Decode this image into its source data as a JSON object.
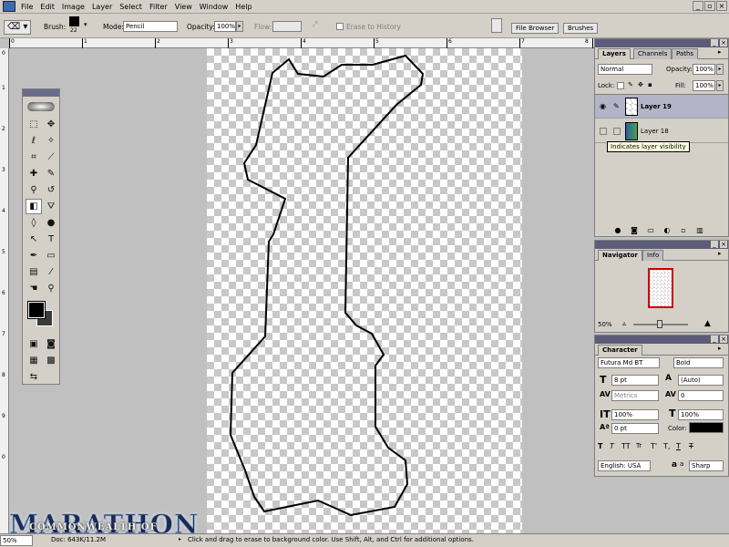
{
  "menu": {
    "items": [
      "File",
      "Edit",
      "Image",
      "Layer",
      "Select",
      "Filter",
      "View",
      "Window",
      "Help"
    ]
  },
  "options": {
    "brush_label": "Brush:",
    "brush_size": "22",
    "mode_label": "Mode:",
    "mode_value": "Pencil",
    "opacity_label": "Opacity:",
    "opacity_value": "100%",
    "flow_label": "Flow:",
    "flow_value": "",
    "erase_history_label": "Erase to History",
    "file_browser": "File Browser",
    "brushes": "Brushes"
  },
  "ruler": {
    "top_labels": [
      "0",
      "1",
      "2",
      "3",
      "4",
      "5",
      "6",
      "7",
      "8"
    ],
    "left_labels": [
      "0",
      "1",
      "2",
      "3",
      "4",
      "5",
      "6",
      "7",
      "8",
      "9",
      "0"
    ]
  },
  "layers_panel": {
    "tabs": [
      "Layers",
      "Channels",
      "Paths"
    ],
    "blend_mode": "Normal",
    "opacity_label": "Opacity:",
    "opacity_value": "100%",
    "lock_label": "Lock:",
    "fill_label": "Fill:",
    "fill_value": "100%",
    "layers": [
      {
        "name": "Layer 19",
        "selected": true
      },
      {
        "name": "Layer 18",
        "selected": false
      }
    ],
    "tooltip": "Indicates layer visibility"
  },
  "navigator_panel": {
    "tabs": [
      "Navigator",
      "Info"
    ],
    "zoom": "50%"
  },
  "character_panel": {
    "tabs": [
      "Character"
    ],
    "font_family": "Futura Md BT",
    "font_style": "Bold",
    "size": "8 pt",
    "leading": "(Auto)",
    "kerning": "Metrics",
    "tracking": "0",
    "vscale": "100%",
    "hscale": "100%",
    "baseline": "0 pt",
    "color_label": "Color:",
    "style_buttons": [
      "T",
      "T",
      "TT",
      "Tr",
      "T'",
      "T,",
      "T",
      "T"
    ],
    "language": "English: USA",
    "aa_label": "a",
    "antialias": "Sharp"
  },
  "status": {
    "zoom": "50%",
    "doc": "Doc: 643K/11.2M",
    "hint": "Click and drag to erase to background color.  Use Shift, Alt, and Ctrl for additional options."
  },
  "logo": {
    "main": "MARATHON",
    "sub": "COMMONWEALTH OF"
  },
  "colors": {
    "panel": "#d4d0c8",
    "title": "#5c5c78",
    "selected_row": "#b4b4c8"
  }
}
